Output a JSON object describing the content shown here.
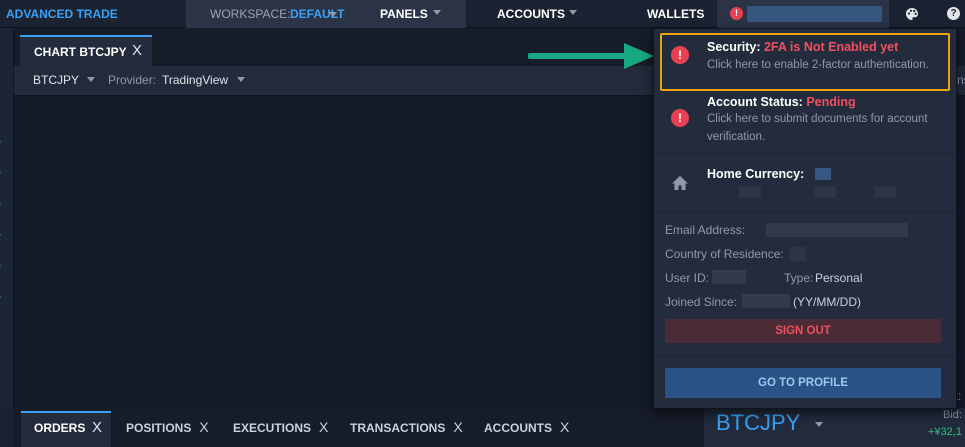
{
  "topbar": {
    "brand": "ADVANCED TRADE",
    "workspace_label": "WORKSPACE:",
    "workspace_value": "DEFAULT",
    "panels_label": "PANELS",
    "accounts_label": "ACCOUNTS",
    "wallets_label": "WALLETS",
    "alert_glyph": "!",
    "help_glyph": "?"
  },
  "chart_panel": {
    "tab_label": "CHART BTCJPY",
    "tab_close": "X",
    "pair": "BTCJPY",
    "provider_label": "Provider:",
    "provider_value": "TradingView",
    "right_edge_text": "ns"
  },
  "bottom_tabs": {
    "active": {
      "label": "ORDERS",
      "close": "X"
    },
    "items": [
      {
        "label": "POSITIONS",
        "close": "X"
      },
      {
        "label": "EXECUTIONS",
        "close": "X"
      },
      {
        "label": "TRANSACTIONS",
        "close": "X"
      },
      {
        "label": "ACCOUNTS",
        "close": "X"
      }
    ]
  },
  "ticker": {
    "symbol": "BTCJPY",
    "bid_label": "Bid:",
    "bid_value": "+¥32,1",
    "ask_partial": "k:"
  },
  "account_menu": {
    "security": {
      "title": "Security:",
      "status": "2FA is Not Enabled yet",
      "description": "Click here to enable 2-factor authentication."
    },
    "account_status": {
      "title": "Account Status:",
      "status": "Pending",
      "description": "Click here to submit documents for account verification."
    },
    "home_currency": {
      "title": "Home Currency:"
    },
    "info": {
      "email_label": "Email Address:",
      "country_label": "Country of Residence:",
      "user_id_label": "User ID:",
      "type_label": "Type:",
      "type_value": "Personal",
      "joined_label": "Joined Since:",
      "joined_format": "(YY/MM/DD)"
    },
    "sign_out_label": "SIGN OUT",
    "go_to_profile_label": "GO TO PROFILE"
  },
  "colors": {
    "accent_blue": "#3aa0f3",
    "alert_red": "#e84152",
    "highlight_orange": "#f0a20a",
    "arrow_green": "#1aa882",
    "positive_green": "#26c281"
  },
  "icons": {
    "palette": "palette-icon",
    "help": "help-icon",
    "home": "home-icon",
    "alert": "alert-icon",
    "close": "close-icon",
    "caret": "chevron-down-icon"
  }
}
